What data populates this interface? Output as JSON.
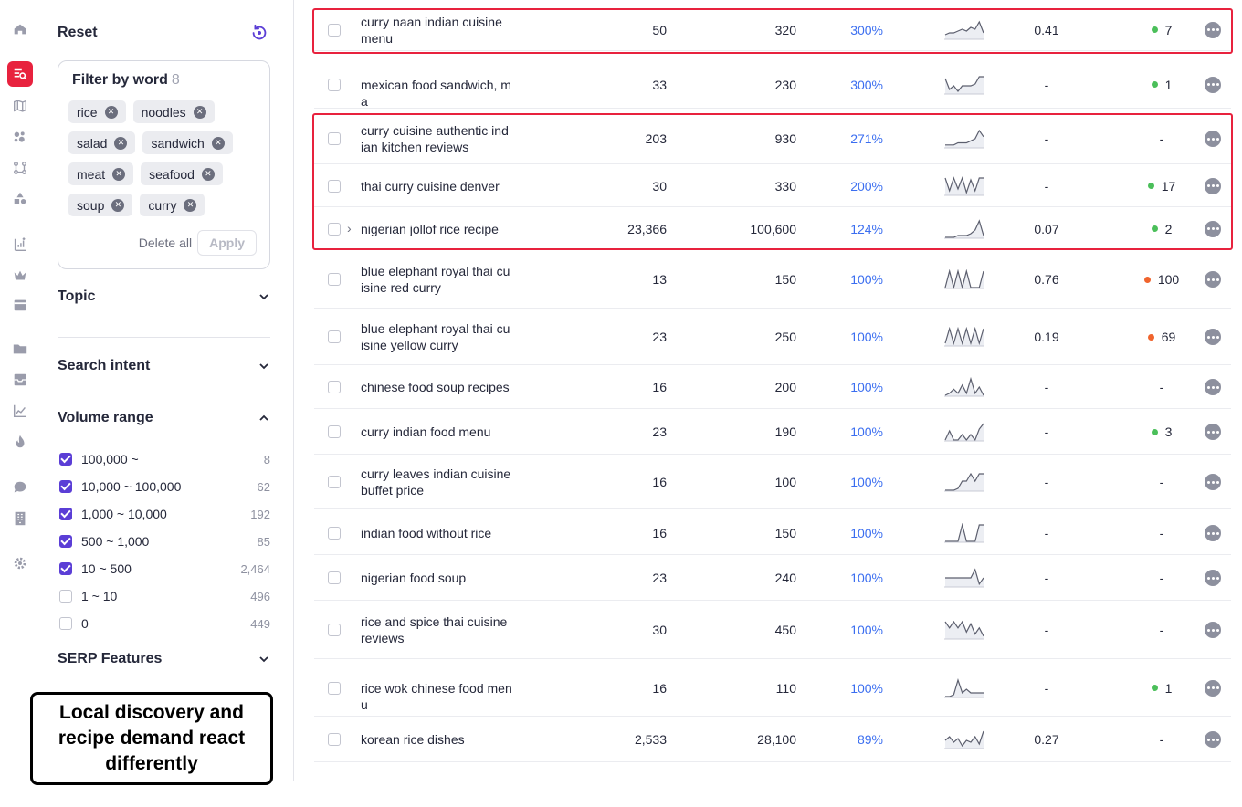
{
  "colors": {
    "brand_red": "#e8223e",
    "accent_purple": "#5b3ed6",
    "growth_blue": "#3b6ef0",
    "dot_green": "#4bbf5a",
    "dot_orange": "#f0642d"
  },
  "rail": {
    "icons": [
      "home-icon",
      "keyword-search-icon",
      "map-icon",
      "cluster-icon",
      "flow-icon",
      "shapes-icon",
      "rank-tracker-icon",
      "crown-icon",
      "archive-box-icon",
      "folder-icon",
      "inbox-icon",
      "chart-icon",
      "fire-icon",
      "chat-icon",
      "building-icon",
      "gear-icon"
    ]
  },
  "filters": {
    "reset_label": "Reset",
    "filter_by_word": {
      "title": "Filter by word",
      "count": "8",
      "chips": [
        [
          "rice",
          "noodles"
        ],
        [
          "salad",
          "sandwich"
        ],
        [
          "meat",
          "seafood"
        ],
        [
          "soup",
          "curry"
        ]
      ],
      "delete_all": "Delete all",
      "apply": "Apply"
    },
    "topic": "Topic",
    "search_intent": "Search intent",
    "volume_range": {
      "title": "Volume range",
      "items": [
        {
          "label": "100,000 ~",
          "count": "8",
          "checked": true
        },
        {
          "label": "10,000 ~ 100,000",
          "count": "62",
          "checked": true
        },
        {
          "label": "1,000 ~ 10,000",
          "count": "192",
          "checked": true
        },
        {
          "label": "500 ~ 1,000",
          "count": "85",
          "checked": true
        },
        {
          "label": "10 ~ 500",
          "count": "2,464",
          "checked": true
        },
        {
          "label": "1 ~ 10",
          "count": "496",
          "checked": false
        },
        {
          "label": "0",
          "count": "449",
          "checked": false
        }
      ]
    },
    "serp_features": "SERP Features"
  },
  "annotation": {
    "text": "Local discovery and recipe demand react differently"
  },
  "table": {
    "rows": [
      {
        "keyword": "curry naan indian cuisine menu",
        "volume": "50",
        "potential": "320",
        "growth": "300%",
        "kd": "0.41",
        "result": "7",
        "dot": "green",
        "trend": [
          2,
          3,
          3,
          4,
          5,
          4,
          6,
          5,
          9,
          3
        ]
      },
      {
        "keyword": "mexican food sandwich, m a",
        "volume": "33",
        "potential": "230",
        "growth": "300%",
        "kd": "-",
        "result": "1",
        "dot": "green",
        "trend": [
          8,
          2,
          4,
          1,
          4,
          4,
          4,
          5,
          9,
          9
        ]
      },
      {
        "keyword": "curry cuisine authentic ind ian kitchen reviews",
        "volume": "203",
        "potential": "930",
        "growth": "271%",
        "kd": "-",
        "result": "-",
        "dot": "",
        "trend": [
          1,
          1,
          1,
          2,
          2,
          2,
          3,
          4,
          8,
          5
        ]
      },
      {
        "keyword": "thai curry cuisine denver",
        "volume": "30",
        "potential": "330",
        "growth": "200%",
        "kd": "-",
        "result": "17",
        "dot": "green",
        "trend": [
          9,
          2,
          9,
          3,
          9,
          1,
          8,
          2,
          9,
          9
        ]
      },
      {
        "keyword": "nigerian jollof rice recipe",
        "volume": "23,366",
        "potential": "100,600",
        "growth": "124%",
        "kd": "0.07",
        "result": "2",
        "dot": "green",
        "expand": true,
        "trend": [
          0,
          0,
          0,
          1,
          1,
          1,
          2,
          4,
          9,
          1
        ]
      },
      {
        "keyword": "blue elephant royal thai cu isine red curry",
        "volume": "13",
        "potential": "150",
        "growth": "100%",
        "kd": "0.76",
        "result": "100",
        "dot": "orange",
        "trend": [
          0,
          9,
          0,
          9,
          0,
          9,
          0,
          0,
          0,
          9
        ]
      },
      {
        "keyword": "blue elephant royal thai cu isine yellow curry",
        "volume": "23",
        "potential": "250",
        "growth": "100%",
        "kd": "0.19",
        "result": "69",
        "dot": "orange",
        "trend": [
          1,
          9,
          1,
          9,
          1,
          9,
          1,
          9,
          1,
          9
        ]
      },
      {
        "keyword": "chinese food soup recipes",
        "volume": "16",
        "potential": "200",
        "growth": "100%",
        "kd": "-",
        "result": "-",
        "dot": "",
        "trend": [
          0,
          1,
          3,
          1,
          5,
          1,
          8,
          1,
          4,
          0
        ]
      },
      {
        "keyword": "curry indian food menu",
        "volume": "23",
        "potential": "190",
        "growth": "100%",
        "kd": "-",
        "result": "3",
        "dot": "green",
        "trend": [
          0,
          5,
          0,
          0,
          3,
          0,
          3,
          0,
          6,
          9
        ]
      },
      {
        "keyword": "curry leaves indian cuisine buffet price",
        "volume": "16",
        "potential": "100",
        "growth": "100%",
        "kd": "-",
        "result": "-",
        "dot": "",
        "trend": [
          0,
          0,
          0,
          1,
          5,
          5,
          9,
          5,
          9,
          9
        ]
      },
      {
        "keyword": "indian food without rice",
        "volume": "16",
        "potential": "150",
        "growth": "100%",
        "kd": "-",
        "result": "-",
        "dot": "",
        "trend": [
          0,
          0,
          0,
          0,
          9,
          0,
          0,
          0,
          9,
          9
        ]
      },
      {
        "keyword": "nigerian food soup",
        "volume": "23",
        "potential": "240",
        "growth": "100%",
        "kd": "-",
        "result": "-",
        "dot": "",
        "trend": [
          4,
          4,
          4,
          4,
          4,
          4,
          4,
          8,
          1,
          4
        ]
      },
      {
        "keyword": "rice and spice thai cuisine reviews",
        "volume": "30",
        "potential": "450",
        "growth": "100%",
        "kd": "-",
        "result": "-",
        "dot": "",
        "trend": [
          8,
          5,
          8,
          5,
          8,
          3,
          7,
          2,
          5,
          1
        ]
      },
      {
        "keyword": "rice wok chinese food men u",
        "volume": "16",
        "potential": "110",
        "growth": "100%",
        "kd": "-",
        "result": "1",
        "dot": "green",
        "trend": [
          0,
          0,
          1,
          9,
          2,
          4,
          2,
          2,
          2,
          2
        ]
      },
      {
        "keyword": "korean rice dishes",
        "volume": "2,533",
        "potential": "28,100",
        "growth": "89%",
        "kd": "0.27",
        "result": "-",
        "dot": "",
        "trend": [
          4,
          6,
          3,
          5,
          1,
          4,
          3,
          6,
          2,
          9
        ]
      }
    ]
  }
}
